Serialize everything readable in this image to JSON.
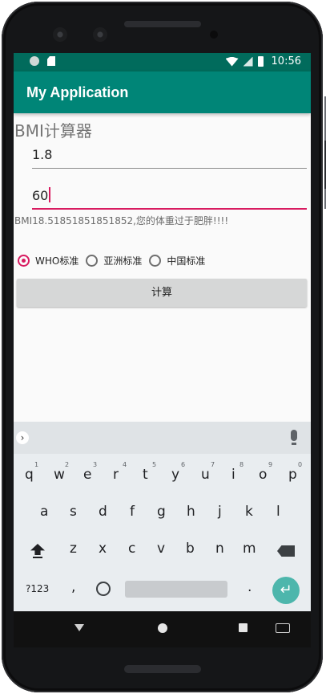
{
  "status_bar": {
    "time": "10:56"
  },
  "app_bar": {
    "title": "My Application"
  },
  "form": {
    "heading": "BMI计算器",
    "height_value": "1.8",
    "weight_value": "60",
    "result_text": "BMI18.51851851851852,您的体重过于肥胖!!!!",
    "radio_options": [
      {
        "label": "WHO标准",
        "checked": true
      },
      {
        "label": "亚洲标准",
        "checked": false
      },
      {
        "label": "中国标准",
        "checked": false
      }
    ],
    "calculate_label": "计算"
  },
  "keyboard": {
    "row1": [
      "q",
      "w",
      "e",
      "r",
      "t",
      "y",
      "u",
      "i",
      "o",
      "p"
    ],
    "row1_hints": [
      "1",
      "2",
      "3",
      "4",
      "5",
      "6",
      "7",
      "8",
      "9",
      "0"
    ],
    "row2": [
      "a",
      "s",
      "d",
      "f",
      "g",
      "h",
      "j",
      "k",
      "l"
    ],
    "row3": [
      "z",
      "x",
      "c",
      "v",
      "b",
      "n",
      "m"
    ],
    "symbols_label": "?123",
    "comma": ",",
    "period": ".",
    "enter_symbol": "↵"
  },
  "colors": {
    "primary": "#008577",
    "primary_dark": "#00574B",
    "accent": "#D81B60"
  }
}
